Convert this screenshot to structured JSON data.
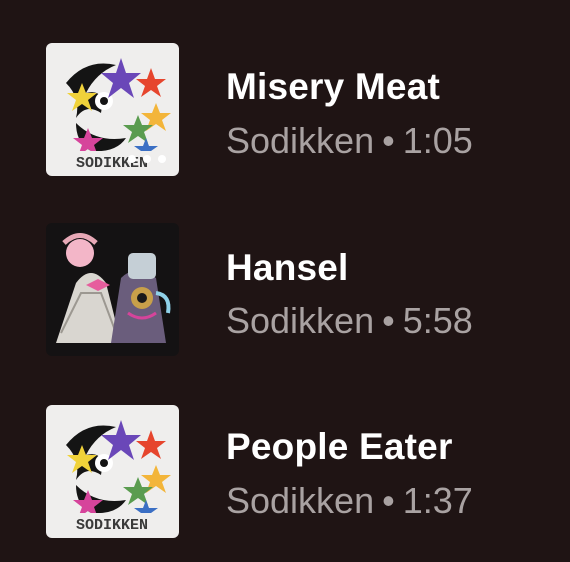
{
  "tracks": [
    {
      "title": "Misery Meat",
      "artist": "Sodikken",
      "separator": "•",
      "duration": "1:05",
      "art": "star-cover-art"
    },
    {
      "title": "Hansel",
      "artist": "Sodikken",
      "separator": "•",
      "duration": "5:58",
      "art": "couple-collage-art"
    },
    {
      "title": "People Eater",
      "artist": "Sodikken",
      "separator": "•",
      "duration": "1:37",
      "art": "star-cover-art"
    }
  ],
  "album_label": "SODIKKEN",
  "colors": {
    "background": "#1f1414",
    "title": "#ffffff",
    "meta": "#a9a2a2"
  }
}
